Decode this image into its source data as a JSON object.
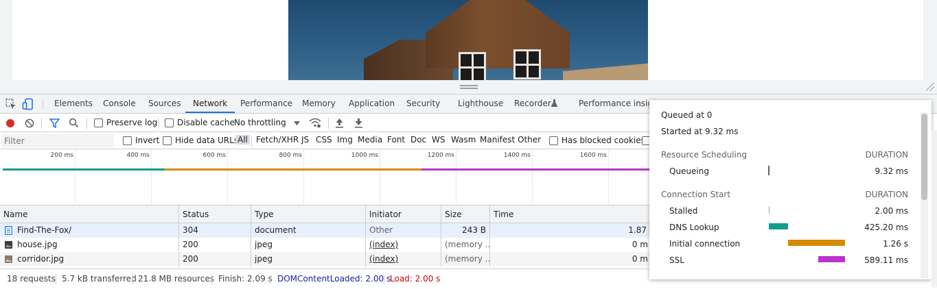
{
  "devtools": {
    "tabs": [
      "Elements",
      "Console",
      "Sources",
      "Network",
      "Performance",
      "Memory",
      "Application",
      "Security",
      "Lighthouse",
      "Recorder",
      "Performance insigh"
    ],
    "active_tab": "Network"
  },
  "toolbar": {
    "preserve_log": "Preserve log",
    "disable_cache": "Disable cache",
    "throttling": "No throttling"
  },
  "filterbar": {
    "placeholder": "Filter",
    "invert": "Invert",
    "hide_data_urls": "Hide data URLs",
    "types": [
      "All",
      "Fetch/XHR",
      "JS",
      "CSS",
      "Img",
      "Media",
      "Font",
      "Doc",
      "WS",
      "Wasm",
      "Manifest",
      "Other"
    ],
    "has_blocked_cookies": "Has blocked cookies"
  },
  "overview": {
    "ticks": [
      "200 ms",
      "400 ms",
      "600 ms",
      "800 ms",
      "1000 ms",
      "1200 ms",
      "1400 ms",
      "1600 ms"
    ],
    "colors": {
      "teal": "#129c8b",
      "orange": "#d68a00",
      "purple": "#b933cc"
    }
  },
  "table": {
    "headers": [
      "Name",
      "Status",
      "Type",
      "Initiator",
      "Size",
      "Time"
    ],
    "rows": [
      {
        "name": "Find-The-Fox/",
        "status": "304",
        "type": "document",
        "initiator": "Other",
        "size": "243 B",
        "time": "1.87",
        "icon": "document-icon"
      },
      {
        "name": "house.jpg",
        "status": "200",
        "type": "jpeg",
        "initiator": "(index)",
        "size": "(memory ...",
        "time": "0 m",
        "icon": "image-icon"
      },
      {
        "name": "corridor.jpg",
        "status": "200",
        "type": "jpeg",
        "initiator": "(index)",
        "size": "(memory ...",
        "time": "0 m",
        "icon": "image-icon"
      }
    ]
  },
  "statusbar": {
    "requests": "18 requests",
    "transferred": "5.7 kB transferred",
    "resources": "21.8 MB resources",
    "finish": "Finish: 2.09 s",
    "dom_content_loaded": "DOMContentLoaded: 2.00 s",
    "load": "Load: 2.00 s",
    "dcl_color": "#1a1aa6",
    "load_color": "#c80000"
  },
  "timing": {
    "queued_at": "Queued at 0",
    "started_at": "Started at 9.32 ms",
    "resource_scheduling": "Resource Scheduling",
    "connection_start": "Connection Start",
    "duration": "DURATION",
    "queueing": {
      "label": "Queueing",
      "value": "9.32 ms"
    },
    "stalled": {
      "label": "Stalled",
      "value": "2.00 ms"
    },
    "dns": {
      "label": "DNS Lookup",
      "value": "425.20 ms"
    },
    "initial_connection": {
      "label": "Initial connection",
      "value": "1.26 s"
    },
    "ssl": {
      "label": "SSL",
      "value": "589.11 ms"
    }
  }
}
